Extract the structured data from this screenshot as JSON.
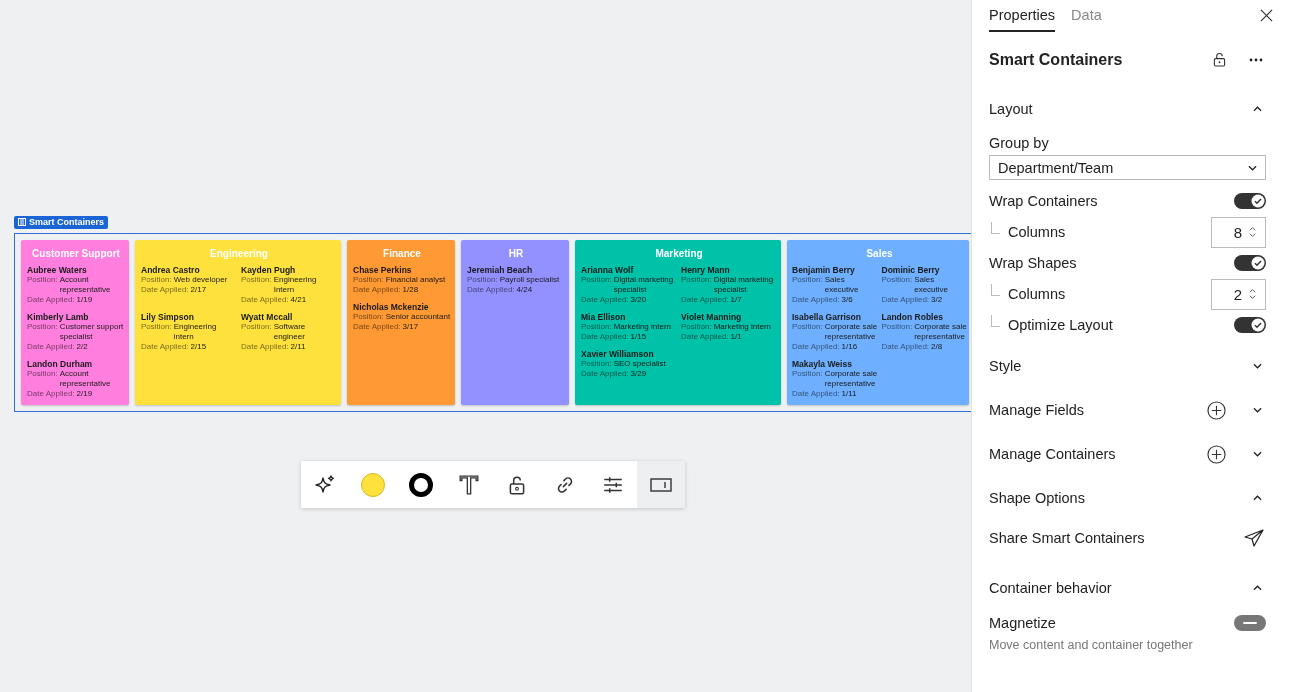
{
  "canvas": {
    "group_label": "Smart Containers",
    "containers": [
      {
        "title": "Customer Support",
        "color": "#ff7ede",
        "people": [
          {
            "name": "Aubree Waters",
            "position_label": "Position:",
            "position": "Account representative",
            "date_label": "Date Applied:",
            "date": "1/19"
          },
          {
            "name": "Kimberly Lamb",
            "position_label": "Position:",
            "position": "Customer support specialist",
            "date_label": "Date Applied:",
            "date": "2/2"
          },
          {
            "name": "Landon Durham",
            "position_label": "Position:",
            "position": "Account representative",
            "date_label": "Date Applied:",
            "date": "2/19"
          }
        ]
      },
      {
        "title": "Engineering",
        "color": "#ffe13d",
        "people": [
          {
            "name": "Andrea Castro",
            "position_label": "Position:",
            "position": "Web developer",
            "date_label": "Date Applied:",
            "date": "2/17"
          },
          {
            "name": "Kayden Pugh",
            "position_label": "Position:",
            "position": "Engineering Intern",
            "date_label": "Date Applied:",
            "date": "4/21"
          },
          {
            "name": "Lily Simpson",
            "position_label": "Position:",
            "position": "Engineering intern",
            "date_label": "Date Applied:",
            "date": "2/15"
          },
          {
            "name": "Wyatt Mccall",
            "position_label": "Position:",
            "position": "Software engineer",
            "date_label": "Date Applied:",
            "date": "2/11"
          }
        ]
      },
      {
        "title": "Finance",
        "color": "#ff9933",
        "people": [
          {
            "name": "Chase Perkins",
            "position_label": "Position:",
            "position": "Financial analyst",
            "date_label": "Date Applied:",
            "date": "1/28"
          },
          {
            "name": "Nicholas Mckenzie",
            "position_label": "Position:",
            "position": "Senior accountant",
            "date_label": "Date Applied:",
            "date": "3/17"
          }
        ]
      },
      {
        "title": "HR",
        "color": "#9391ff",
        "people": [
          {
            "name": "Jeremiah Beach",
            "position_label": "Position:",
            "position": "Payroll specialist",
            "date_label": "Date Applied:",
            "date": "4/24"
          }
        ]
      },
      {
        "title": "Marketing",
        "color": "#00c2a8",
        "people": [
          {
            "name": "Arianna Wolf",
            "position_label": "Position:",
            "position": "Digital marketing specialist",
            "date_label": "Date Applied:",
            "date": "3/20"
          },
          {
            "name": "Henry Mann",
            "position_label": "Position:",
            "position": "Digital marketing specialist",
            "date_label": "Date Applied:",
            "date": "1/7"
          },
          {
            "name": "Mia Ellison",
            "position_label": "Position:",
            "position": "Marketing intern",
            "date_label": "Date Applied:",
            "date": "1/15"
          },
          {
            "name": "Violet Manning",
            "position_label": "Position:",
            "position": "Marketing intern",
            "date_label": "Date Applied:",
            "date": "1/1"
          },
          {
            "name": "Xavier Williamson",
            "position_label": "Position:",
            "position": "SEO specialist",
            "date_label": "Date Applied:",
            "date": "3/29"
          }
        ]
      },
      {
        "title": "Sales",
        "color": "#6eb0ff",
        "people": [
          {
            "name": "Benjamin Berry",
            "position_label": "Position:",
            "position": "Sales executive",
            "date_label": "Date Applied:",
            "date": "3/6"
          },
          {
            "name": "Dominic Berry",
            "position_label": "Position:",
            "position": "Sales executive",
            "date_label": "Date Applied:",
            "date": "3/2"
          },
          {
            "name": "Isabella Garrison",
            "position_label": "Position:",
            "position": "Corporate sale representative",
            "date_label": "Date Applied:",
            "date": "1/16"
          },
          {
            "name": "Landon Robles",
            "position_label": "Position:",
            "position": "Corporate sale representative",
            "date_label": "Date Applied:",
            "date": "2/8"
          },
          {
            "name": "Makayla Weiss",
            "position_label": "Position:",
            "position": "Corporate sale representative",
            "date_label": "Date Applied:",
            "date": "1/11"
          }
        ]
      }
    ]
  },
  "toolbar": {
    "items": [
      {
        "kind": "sparkle",
        "selected": false
      },
      {
        "kind": "fill",
        "selected": false,
        "color": "#ffe13d"
      },
      {
        "kind": "stroke",
        "selected": false,
        "color": "#000000"
      },
      {
        "kind": "text",
        "selected": false
      },
      {
        "kind": "lock",
        "selected": false
      },
      {
        "kind": "link",
        "selected": false
      },
      {
        "kind": "sliders",
        "selected": false
      },
      {
        "kind": "panel",
        "selected": true
      }
    ]
  },
  "panel": {
    "tabs": [
      {
        "label": "Properties",
        "selected": true
      },
      {
        "label": "Data",
        "selected": false
      }
    ],
    "title": "Smart Containers",
    "sections": [
      {
        "title": "Layout",
        "expanded": true,
        "add": false,
        "children": [
          {
            "kind": "select",
            "label": "Group by",
            "value": "Department/Team"
          },
          {
            "kind": "toggle",
            "label": "Wrap Containers",
            "on": true,
            "children": [
              {
                "kind": "stepper",
                "label": "Columns",
                "value": "8"
              }
            ]
          },
          {
            "kind": "toggle",
            "label": "Wrap Shapes",
            "on": true,
            "children": [
              {
                "kind": "stepper",
                "label": "Columns",
                "value": "2"
              },
              {
                "kind": "toggle",
                "label": "Optimize Layout",
                "on": true
              }
            ]
          }
        ]
      },
      {
        "title": "Style",
        "expanded": false,
        "add": false
      },
      {
        "title": "Manage Fields",
        "expanded": false,
        "add": true
      },
      {
        "title": "Manage Containers",
        "expanded": false,
        "add": true
      },
      {
        "title": "Shape Options",
        "expanded": true,
        "add": false,
        "children": [
          {
            "kind": "action",
            "label": "Share Smart Containers"
          }
        ]
      },
      {
        "title": "Container behavior",
        "expanded": true,
        "add": false,
        "children": [
          {
            "kind": "toggle",
            "label": "Magnetize",
            "on": false,
            "description": "Move content and container together"
          }
        ]
      }
    ]
  }
}
